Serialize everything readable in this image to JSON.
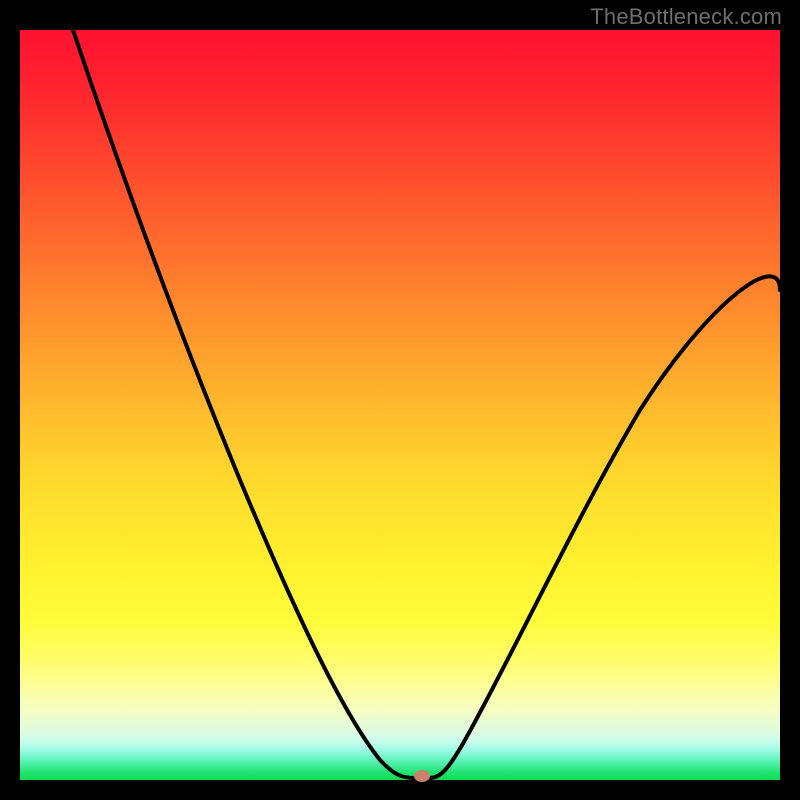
{
  "watermark": "TheBottleneck.com",
  "colors": {
    "frame": "#000000",
    "curve": "#000000",
    "marker": "#c9816e"
  },
  "chart_data": {
    "type": "line",
    "title": "",
    "xlabel": "",
    "ylabel": "",
    "xlim": [
      0,
      100
    ],
    "ylim": [
      0,
      100
    ],
    "x": [
      7,
      10,
      15,
      20,
      25,
      30,
      35,
      40,
      44,
      47,
      49,
      51,
      53,
      55,
      58,
      60,
      65,
      70,
      75,
      80,
      85,
      90,
      95,
      100
    ],
    "values": [
      100,
      91,
      78,
      66,
      55,
      45,
      35,
      26,
      17,
      9,
      3,
      1,
      1,
      2,
      6,
      10,
      19,
      28,
      36,
      44,
      50,
      56,
      61,
      65
    ],
    "minimum_at": {
      "x": 52,
      "y": 0.5
    },
    "annotations": []
  }
}
